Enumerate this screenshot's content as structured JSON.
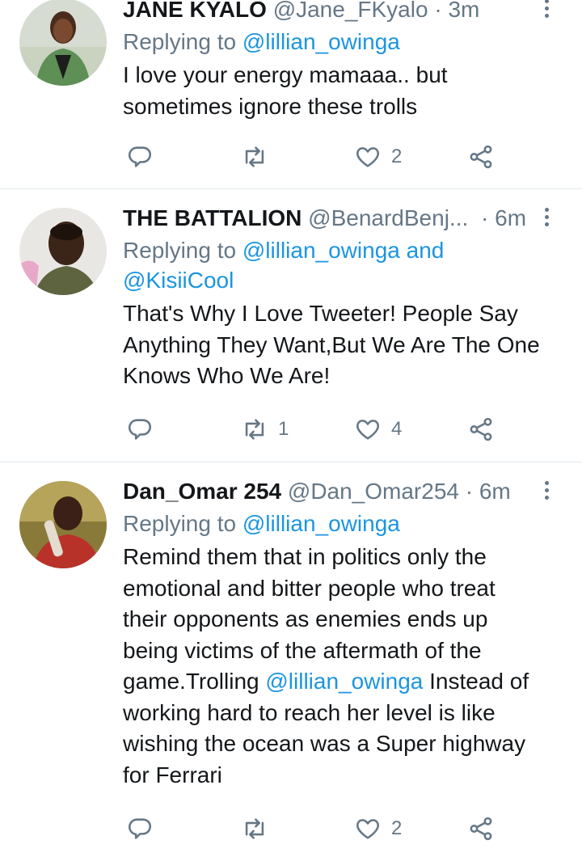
{
  "tweets": [
    {
      "name": "JANE KYALO",
      "handle": "@Jane_FKyalo",
      "separator": "·",
      "time": "3m",
      "reply_label": "Replying to",
      "reply_mentions": [
        "@lillian_owinga"
      ],
      "text_lines": [
        "I love your energy mamaaa.. but",
        "sometimes ignore these trolls"
      ],
      "retweet_count": "",
      "like_count": "2"
    },
    {
      "name": "THE BATTALION",
      "handle": "@BenardBenj...",
      "separator": "·",
      "time": "6m",
      "reply_label": "Replying to",
      "reply_mentions": [
        "@lillian_owinga",
        "and",
        "@KisiiCool"
      ],
      "text_lines": [
        "That's Why I Love Tweeter! People Say",
        "Anything They Want,But We Are The One",
        "Knows Who We Are!"
      ],
      "retweet_count": "1",
      "like_count": "4"
    },
    {
      "name": "Dan_Omar 254",
      "handle": "@Dan_Omar254",
      "separator": "·",
      "time": "6m",
      "reply_label": "Replying to",
      "reply_mentions": [
        "@lillian_owinga"
      ],
      "text_lines": [
        "Remind them that in politics only the",
        "emotional and bitter people who treat",
        "their opponents as enemies ends up",
        "being victims of the aftermath of the",
        "game.Trolling",
        "@lillian_owinga",
        "Instead of",
        "working hard to reach her level is like",
        "wishing the ocean was a Super highway",
        "for Ferrari"
      ],
      "retweet_count": "",
      "like_count": "2"
    }
  ],
  "icons": {
    "reply": "reply-icon",
    "retweet": "retweet-icon",
    "like": "heart-icon",
    "share": "share-icon",
    "more": "more-vertical-icon"
  },
  "colors": {
    "link": "#1b95e0",
    "muted": "#657786",
    "text": "#14171a",
    "divider": "#e1e8ed"
  }
}
